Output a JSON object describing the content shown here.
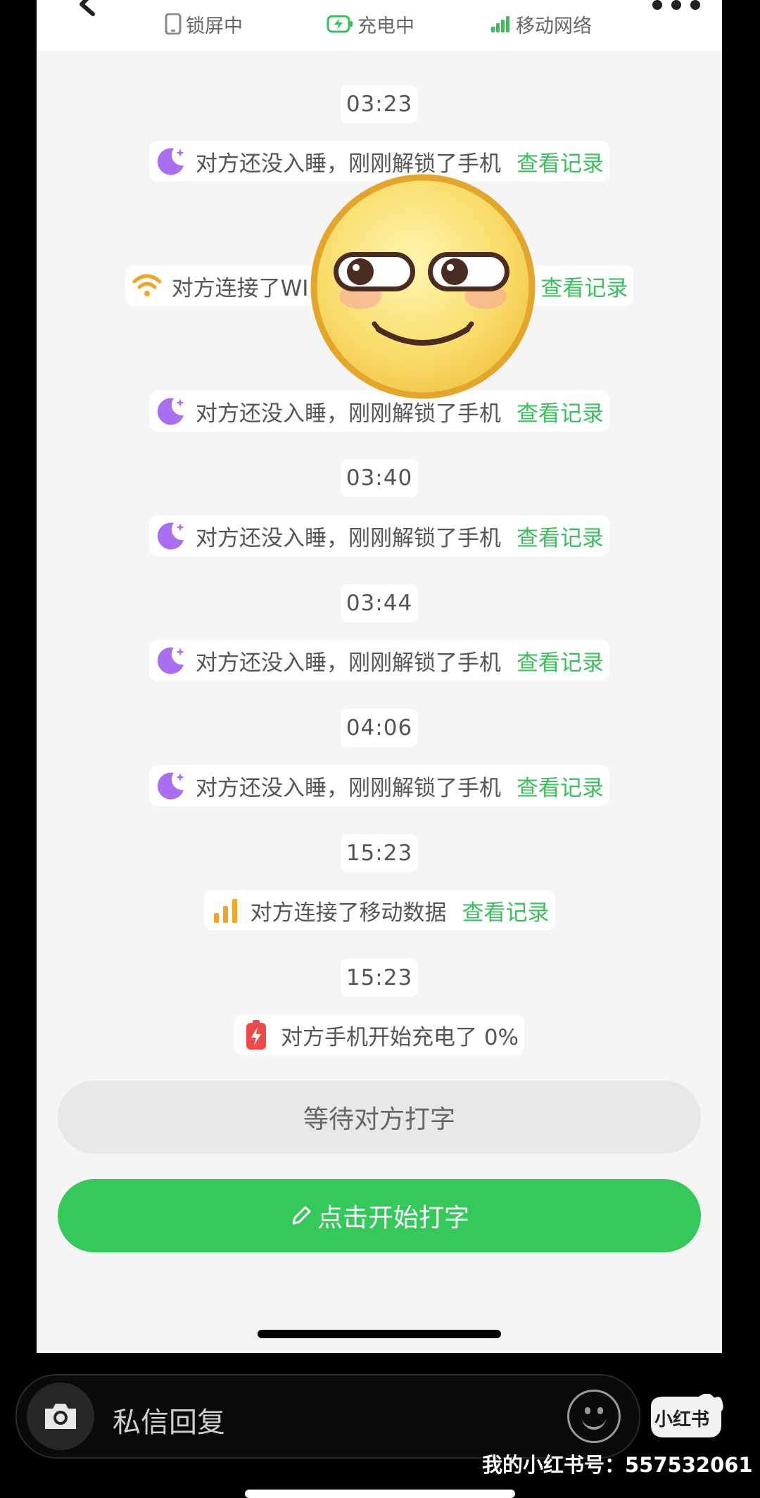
{
  "status": {
    "lock_label": "锁屏中",
    "charge_label": "充电中",
    "network_label": "移动网络"
  },
  "timeline": [
    {
      "type": "time",
      "text": "03:23"
    },
    {
      "type": "event",
      "icon": "moon-icon",
      "text": "对方还没入睡，刚刚解锁了手机",
      "link": "查看记录"
    },
    {
      "type": "event",
      "icon": "wifi-icon",
      "text": "对方连接了WI",
      "link": "查看记录"
    },
    {
      "type": "event",
      "icon": "moon-icon",
      "text": "对方还没入睡，刚刚解锁了手机",
      "link": "查看记录"
    },
    {
      "type": "time",
      "text": "03:40"
    },
    {
      "type": "event",
      "icon": "moon-icon",
      "text": "对方还没入睡，刚刚解锁了手机",
      "link": "查看记录"
    },
    {
      "type": "time",
      "text": "03:44"
    },
    {
      "type": "event",
      "icon": "moon-icon",
      "text": "对方还没入睡，刚刚解锁了手机",
      "link": "查看记录"
    },
    {
      "type": "time",
      "text": "04:06"
    },
    {
      "type": "event",
      "icon": "moon-icon",
      "text": "对方还没入睡，刚刚解锁了手机",
      "link": "查看记录"
    },
    {
      "type": "time",
      "text": "15:23"
    },
    {
      "type": "event",
      "icon": "signal-icon",
      "text": "对方连接了移动数据",
      "link": "查看记录"
    },
    {
      "type": "time",
      "text": "15:23"
    },
    {
      "type": "event",
      "icon": "battery-icon",
      "text": "对方手机开始充电了 0%",
      "link": ""
    }
  ],
  "buttons": {
    "wait_label": "等待对方打字",
    "type_label": "点击开始打字"
  },
  "reply": {
    "placeholder": "私信回复"
  },
  "logo_text": "小红书",
  "watermark": "我的小红书号：557532061",
  "colors": {
    "accent_green": "#3bbf5d",
    "button_green": "#35c85a",
    "moon_purple": "#a96ff0",
    "wifi_orange": "#f1a32a",
    "battery_red": "#ef4a4a"
  }
}
